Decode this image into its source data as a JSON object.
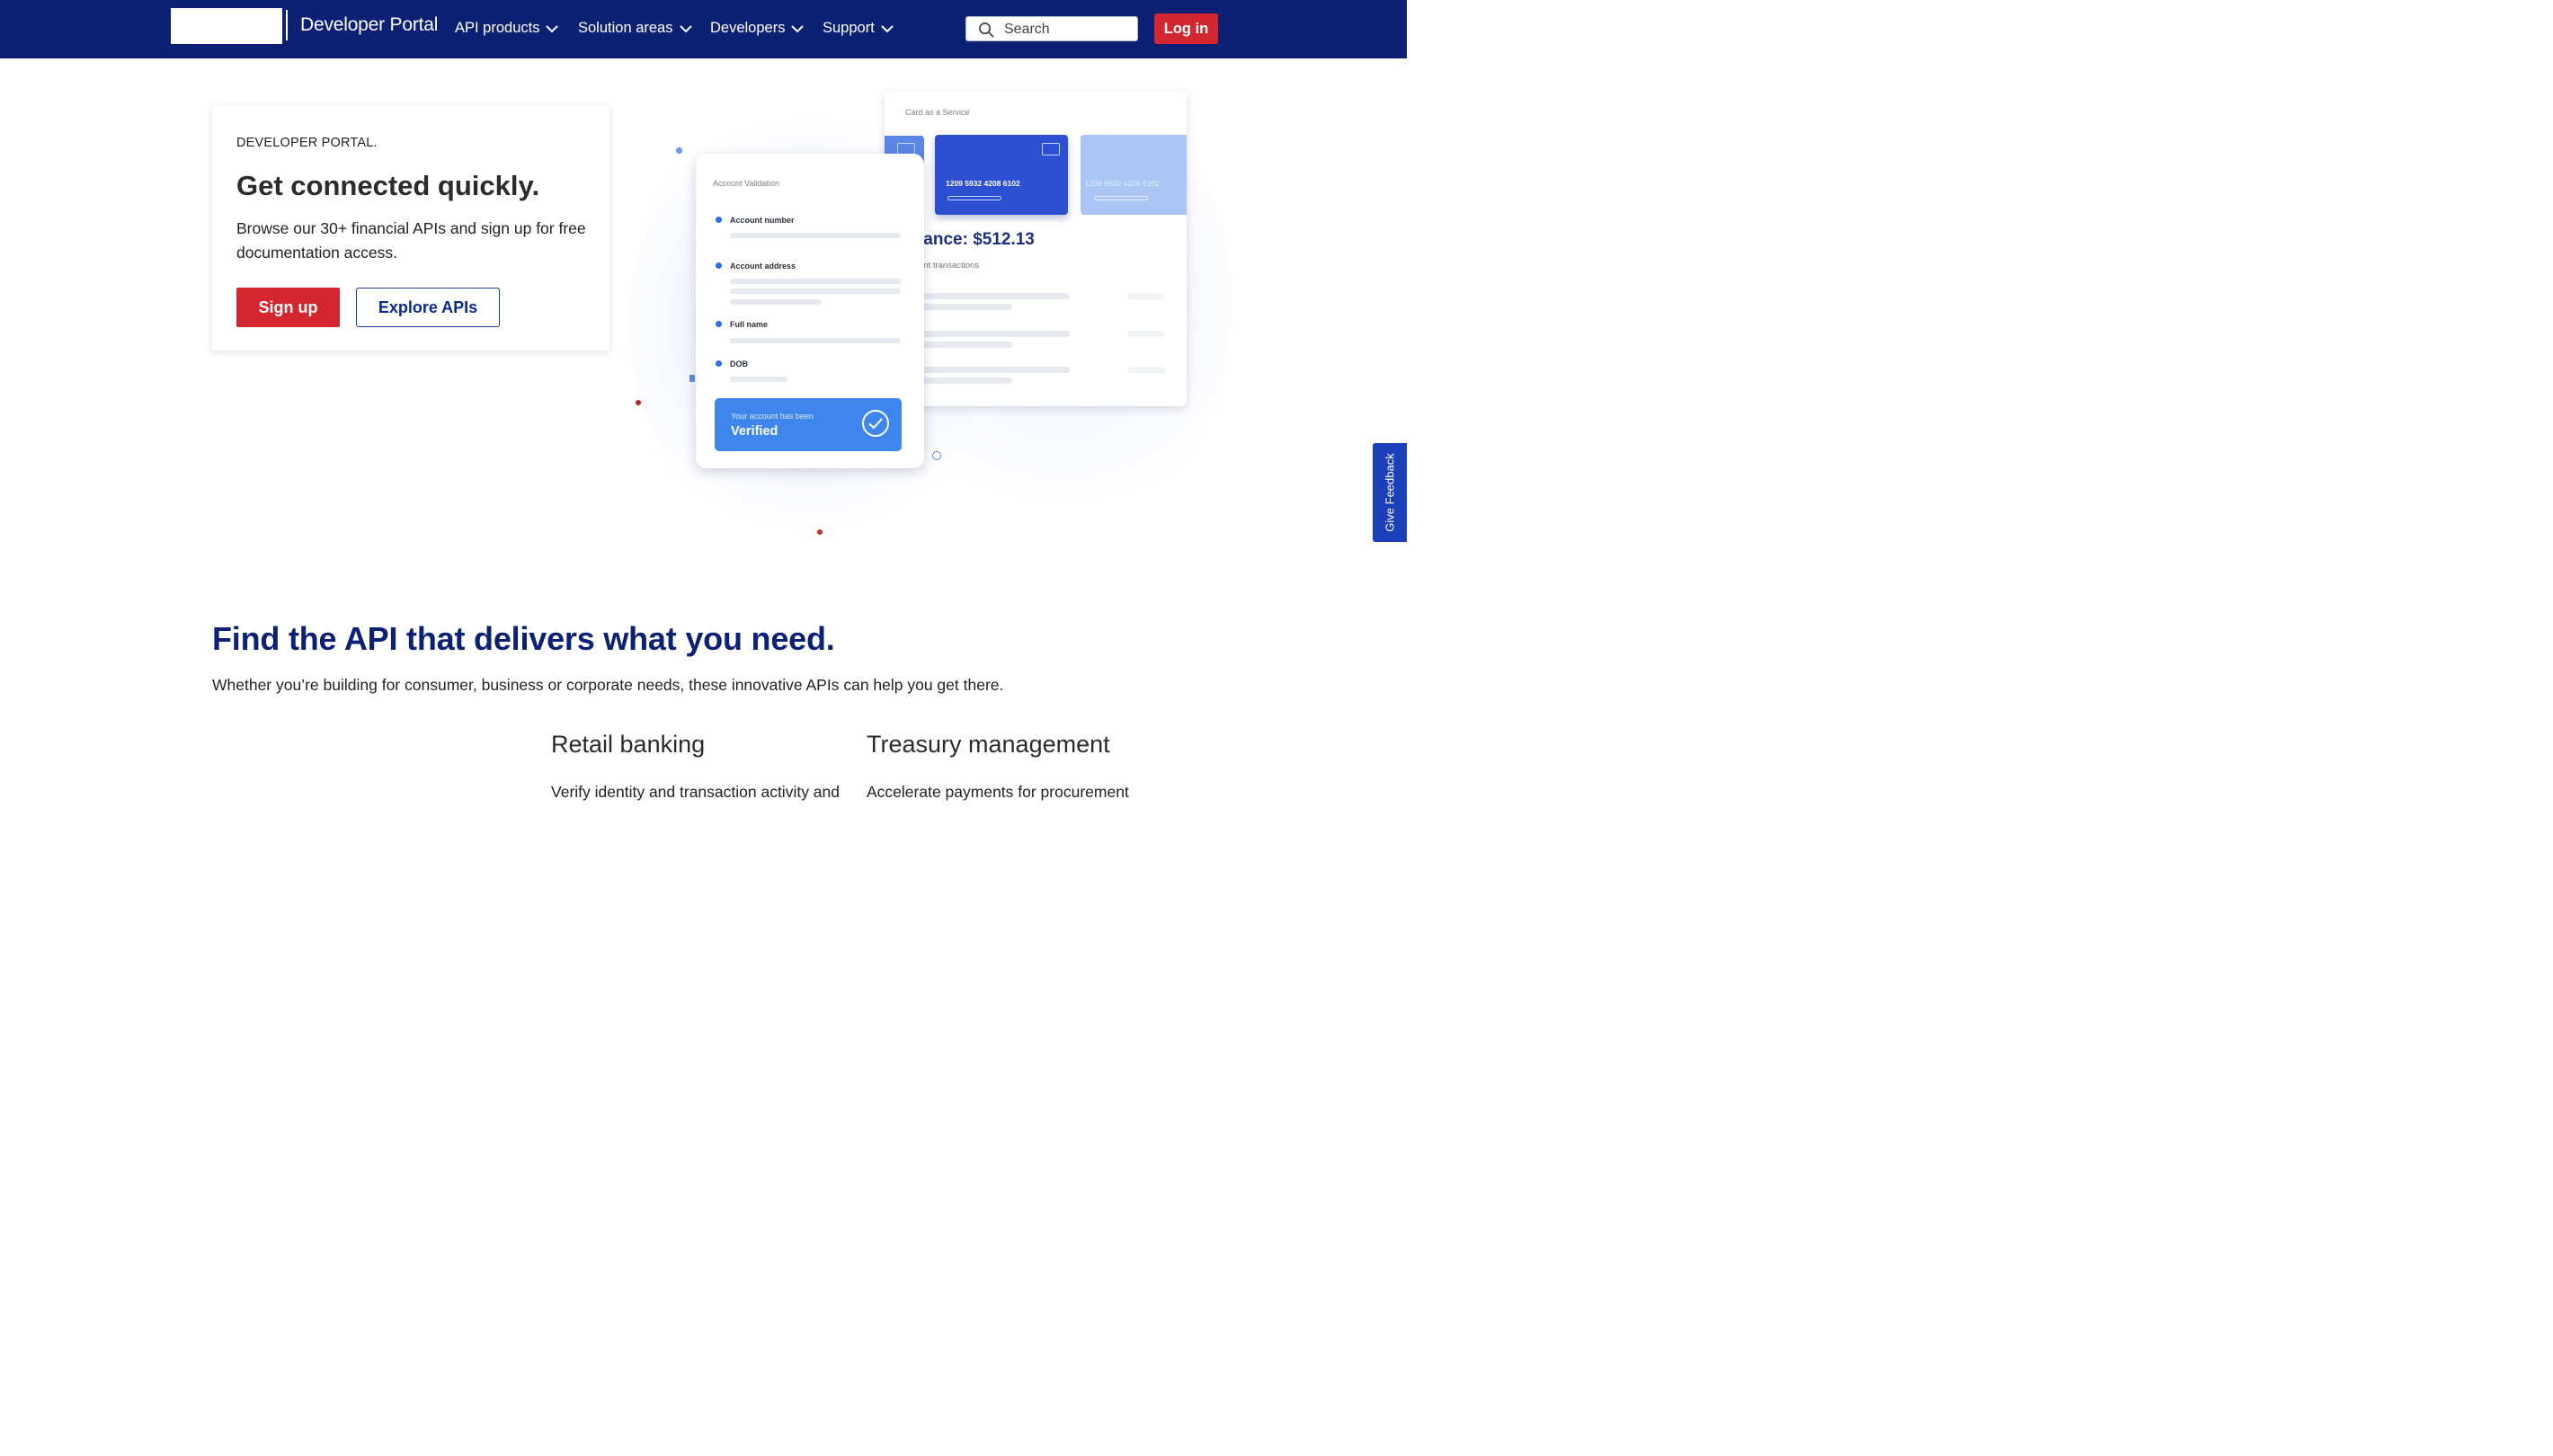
{
  "nav": {
    "brand": "Developer Portal",
    "menu": [
      {
        "label": "API products"
      },
      {
        "label": "Solution areas"
      },
      {
        "label": "Developers"
      },
      {
        "label": "Support"
      }
    ],
    "search_placeholder": "Search",
    "login_label": "Log in"
  },
  "hero": {
    "eyebrow": "DEVELOPER PORTAL.",
    "title": "Get connected quickly.",
    "text": "Browse our 30+ financial APIs and sign up for free documentation access.",
    "signup_label": "Sign up",
    "explore_label": "Explore APIs"
  },
  "illustration": {
    "card_service_title": "Card as a Service",
    "card_number_main": "1209 5932 4208 6102",
    "card_number_secondary": "1209 5932 4208 6102",
    "balance_text": "lance: $512.13",
    "recent_text": "ent transactions",
    "validation_title": "Account Validation",
    "fields": [
      {
        "label": "Account number"
      },
      {
        "label": "Account address"
      },
      {
        "label": "Full name"
      },
      {
        "label": "DOB"
      }
    ],
    "verified_small": "Your account has been",
    "verified_big": "Verified"
  },
  "feedback_label": "Give Feedback",
  "section": {
    "title": "Find the API that delivers what you need.",
    "subtitle": "Whether you’re building for consumer, business or corporate needs, these innovative APIs can help you get there.",
    "columns": [
      {
        "title": "Retail banking",
        "text": "Verify identity and transaction activity and"
      },
      {
        "title": "Treasury management",
        "text": "Accelerate payments for procurement"
      }
    ]
  },
  "colors": {
    "nav_bg": "#0c2074",
    "accent_red": "#d4262e",
    "heading_blue": "#0c2074",
    "card_blue": "#2c4fd4",
    "verified_blue": "#3f86ec"
  }
}
